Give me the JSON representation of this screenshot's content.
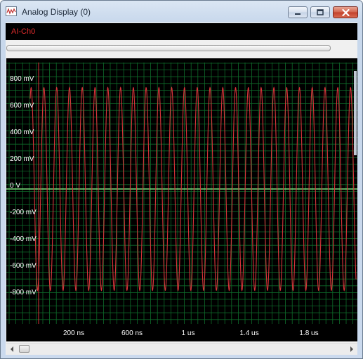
{
  "window": {
    "title": "Analog Display (0)",
    "icon": "oscilloscope-icon",
    "controls": [
      "minimize-icon",
      "maximize-icon",
      "close-icon"
    ]
  },
  "channel": {
    "label": "AI-Ch0",
    "color": "#e22d2d"
  },
  "colors": {
    "background": "#000000",
    "grid": "#0e6b2a",
    "axis": "#7fe07f",
    "trace": "#d8343a",
    "label": "#ffffff"
  },
  "chart_data": {
    "type": "line",
    "title": "",
    "xlabel": "",
    "ylabel": "",
    "series": [
      {
        "name": "AI-Ch0",
        "waveform": "sine",
        "amplitude_mv": 760,
        "cycles": 25.5
      }
    ],
    "y_ticks": [
      "800 mV",
      "600 mV",
      "400 mV",
      "200 mV",
      "0 V",
      "-200 mV",
      "-400 mV",
      "-600 mV",
      "-800 mV"
    ],
    "x_ticks": [
      "200 ns",
      "600 ns",
      "1 us",
      "1.4 us",
      "1.8 us"
    ],
    "ylim": [
      -800,
      800
    ],
    "grid": true
  }
}
